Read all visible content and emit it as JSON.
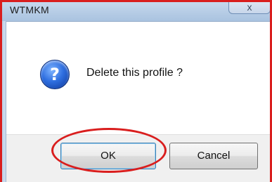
{
  "window": {
    "title": "WTMKM",
    "close_glyph": "x"
  },
  "dialog": {
    "icon": "question-icon",
    "icon_glyph": "?",
    "message": "Delete this profile ?"
  },
  "buttons": {
    "ok_label": "OK",
    "cancel_label": "Cancel"
  },
  "colors": {
    "annotation": "#d91e1e",
    "icon_blue": "#2f6fe0",
    "titlebar": "#b7cde6"
  }
}
